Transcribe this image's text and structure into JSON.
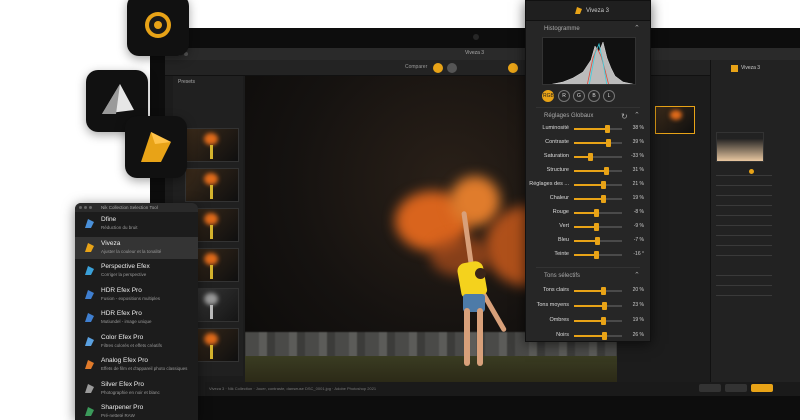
{
  "app": {
    "window_title": "Viveza 3",
    "colors": {
      "accent": "#e8a317",
      "panel": "#262626",
      "background": "#1c1c1c"
    }
  },
  "toolbar": {
    "compare_label": "Comparer"
  },
  "filmstrip": {
    "title": "Presets"
  },
  "statusbar": {
    "text": "Viveza 3 · Nik Collection · Jouer, contraste, danseuse DSC_0001.jpg · Adobe Photoshop 2021"
  },
  "right_panel": {
    "title": "Viveza 3"
  },
  "viveza_panel": {
    "title": "Viveza 3",
    "histogram": {
      "title": "Histogramme"
    },
    "channels": [
      "RGB",
      "R",
      "G",
      "B",
      "L"
    ],
    "global": {
      "title": "Réglages Globaux",
      "sliders": [
        {
          "label": "Luminosité",
          "value": "38 %",
          "level": 0.69
        },
        {
          "label": "Contraste",
          "value": "39 %",
          "level": 0.7
        },
        {
          "label": "Saturation",
          "value": "-33 %",
          "level": 0.34
        },
        {
          "label": "Structure",
          "value": "31 %",
          "level": 0.66
        },
        {
          "label": "Réglages des ...",
          "value": "21 %",
          "level": 0.61
        },
        {
          "label": "Chaleur",
          "value": "19 %",
          "level": 0.6
        },
        {
          "label": "Rouge",
          "value": "-8 %",
          "level": 0.46
        },
        {
          "label": "Vert",
          "value": "-9 %",
          "level": 0.46
        },
        {
          "label": "Bleu",
          "value": "-7 %",
          "level": 0.47
        },
        {
          "label": "Teinte",
          "value": "-16 °",
          "level": 0.46
        }
      ]
    },
    "selective": {
      "title": "Tons sélectifs",
      "sliders": [
        {
          "label": "Tons clairs",
          "value": "20 %",
          "level": 0.6
        },
        {
          "label": "Tons moyens",
          "value": "23 %",
          "level": 0.62
        },
        {
          "label": "Ombres",
          "value": "19 %",
          "level": 0.6
        },
        {
          "label": "Noirs",
          "value": "26 %",
          "level": 0.63
        }
      ]
    }
  },
  "nik_selector": {
    "title": "Nik Collection Selection Tool",
    "items": [
      {
        "name": "Dfine",
        "desc": "Réduction du bruit",
        "icon": "dfine-icon",
        "color": "#4a90d9"
      },
      {
        "name": "Viveza",
        "desc": "Ajuster la couleur et la tonalité",
        "icon": "viveza-icon",
        "color": "#e8a317"
      },
      {
        "name": "Perspective Efex",
        "desc": "Corriger la perspective",
        "icon": "perspective-efex-icon",
        "color": "#3aa0d8"
      },
      {
        "name": "HDR Efex Pro",
        "desc": "Fusion - expositions multiples",
        "icon": "hdr-efex-icon",
        "color": "#3f7fd0"
      },
      {
        "name": "HDR Efex Pro",
        "desc": "Mutiundel - image unique",
        "icon": "hdr-efex-single-icon",
        "color": "#3f7fd0"
      },
      {
        "name": "Color Efex Pro",
        "desc": "Filtres colorés et effets créatifs",
        "icon": "color-efex-icon",
        "color": "#5aa0e0"
      },
      {
        "name": "Analog Efex Pro",
        "desc": "Effets de film et d'appareil photo classiques",
        "icon": "analog-efex-icon",
        "color": "#e07a2a"
      },
      {
        "name": "Silver Efex Pro",
        "desc": "Photographie en noir et blanc",
        "icon": "silver-efex-icon",
        "color": "#9a9a9a"
      },
      {
        "name": "Sharpener Pro",
        "desc": "Pré-netteté RAW",
        "icon": "sharpener-icon",
        "color": "#3b9a5a"
      }
    ]
  }
}
